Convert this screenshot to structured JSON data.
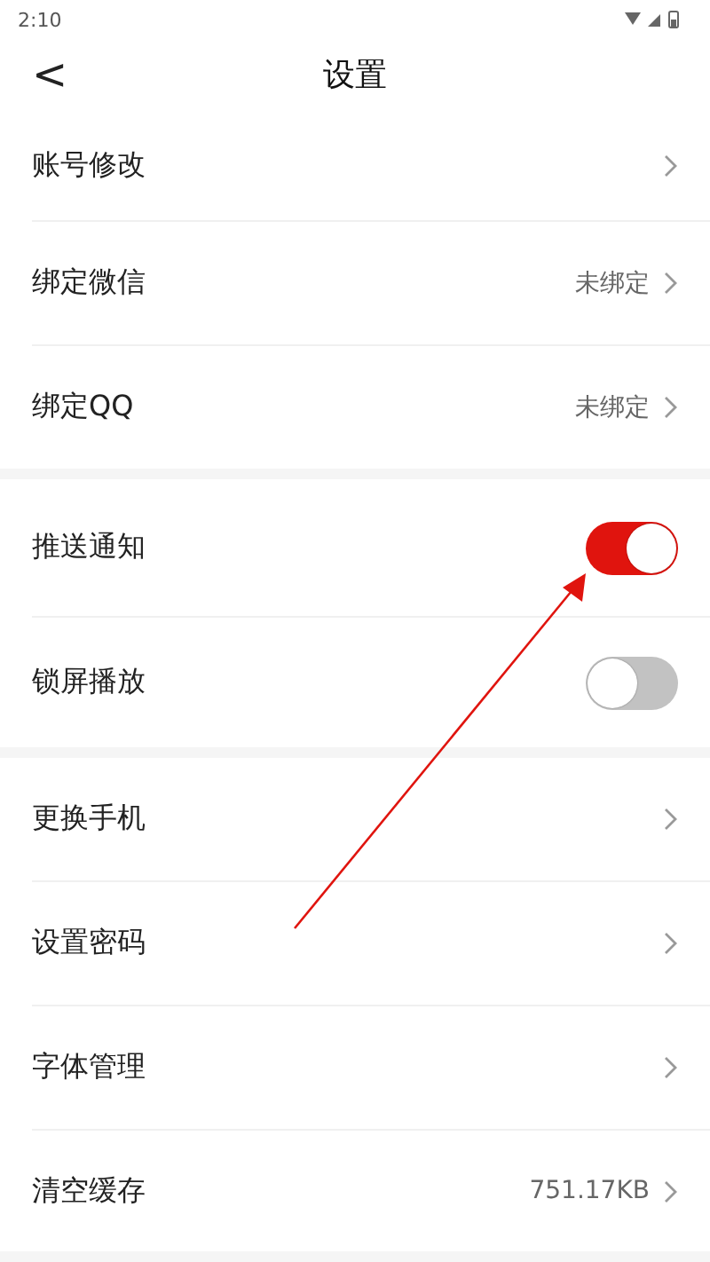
{
  "status_bar": {
    "time": "2:10"
  },
  "header": {
    "back": "<",
    "title": "设置"
  },
  "groups": [
    {
      "items": [
        {
          "kind": "link",
          "label": "账号修改"
        },
        {
          "kind": "link",
          "label": "绑定微信",
          "value": "未绑定"
        },
        {
          "kind": "link",
          "label": "绑定QQ",
          "value": "未绑定"
        }
      ]
    },
    {
      "items": [
        {
          "kind": "toggle",
          "label": "推送通知",
          "on": true
        },
        {
          "kind": "toggle",
          "label": "锁屏播放",
          "on": false
        }
      ]
    },
    {
      "items": [
        {
          "kind": "link",
          "label": "更换手机"
        },
        {
          "kind": "link",
          "label": "设置密码"
        },
        {
          "kind": "link",
          "label": "字体管理"
        },
        {
          "kind": "link",
          "label": "清空缓存",
          "value": "751.17KB"
        }
      ]
    }
  ]
}
